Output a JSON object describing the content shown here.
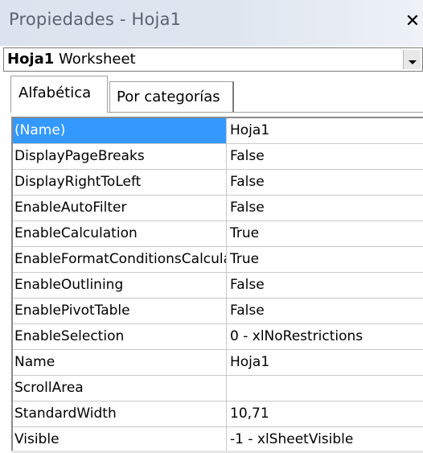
{
  "window": {
    "title": "Propiedades - Hoja1",
    "close_symbol": "✕"
  },
  "object_selector": {
    "name": "Hoja1",
    "type": "Worksheet"
  },
  "tabs": [
    {
      "label": "Alfabética",
      "active": true
    },
    {
      "label": "Por categorías",
      "active": false
    }
  ],
  "properties": [
    {
      "name": "(Name)",
      "value": "Hoja1",
      "selected": true
    },
    {
      "name": "DisplayPageBreaks",
      "value": "False"
    },
    {
      "name": "DisplayRightToLeft",
      "value": "False"
    },
    {
      "name": "EnableAutoFilter",
      "value": "False"
    },
    {
      "name": "EnableCalculation",
      "value": "True"
    },
    {
      "name": "EnableFormatConditionsCalculation",
      "value": "True"
    },
    {
      "name": "EnableOutlining",
      "value": "False"
    },
    {
      "name": "EnablePivotTable",
      "value": "False"
    },
    {
      "name": "EnableSelection",
      "value": "0 - xlNoRestrictions"
    },
    {
      "name": "Name",
      "value": "Hoja1"
    },
    {
      "name": "ScrollArea",
      "value": ""
    },
    {
      "name": "StandardWidth",
      "value": "10,71"
    },
    {
      "name": "Visible",
      "value": "-1 - xlSheetVisible"
    }
  ],
  "colors": {
    "selection": "#3399ff",
    "title_bg": "#dfe6f0"
  }
}
